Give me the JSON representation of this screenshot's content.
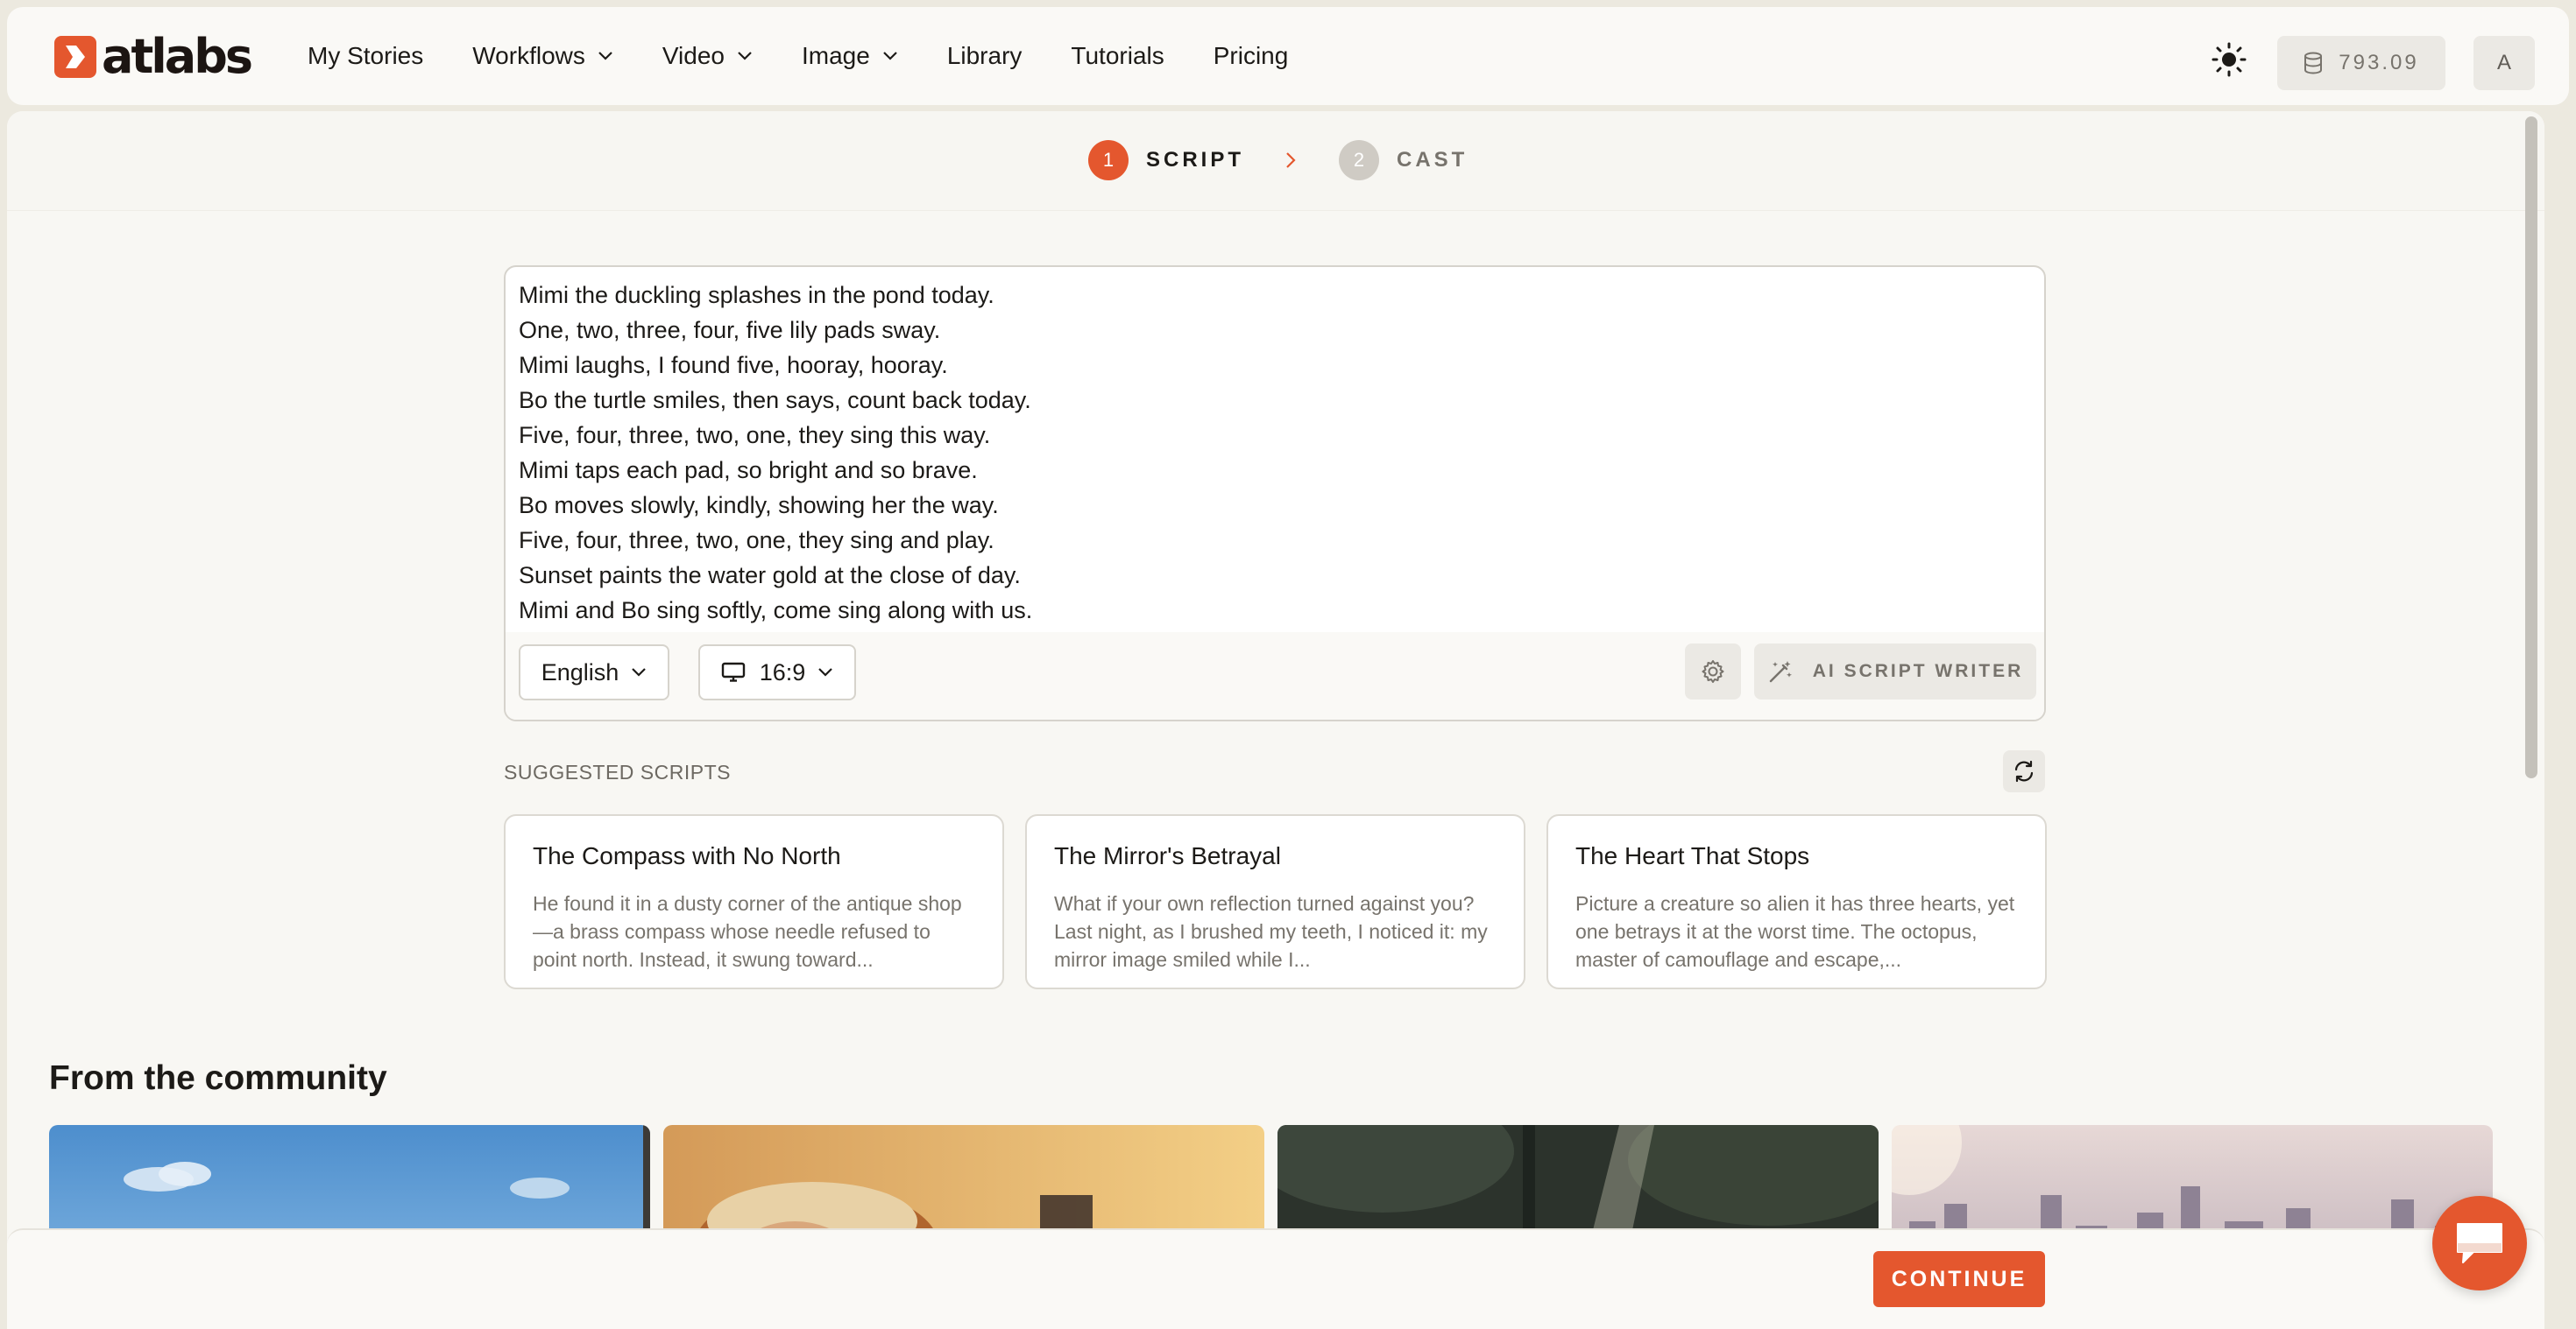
{
  "app": {
    "logo_text": "atlabs"
  },
  "nav": {
    "items": [
      {
        "label": "My Stories",
        "dropdown": false
      },
      {
        "label": "Workflows",
        "dropdown": true
      },
      {
        "label": "Video",
        "dropdown": true
      },
      {
        "label": "Image",
        "dropdown": true
      },
      {
        "label": "Library",
        "dropdown": false
      },
      {
        "label": "Tutorials",
        "dropdown": false
      },
      {
        "label": "Pricing",
        "dropdown": false
      }
    ],
    "theme_icon": "sun-icon",
    "credits": "793.09",
    "credits_icon": "database-icon",
    "avatar_initial": "A"
  },
  "steps": [
    {
      "number": "1",
      "label": "SCRIPT",
      "active": true
    },
    {
      "number": "2",
      "label": "CAST",
      "active": false
    }
  ],
  "editor": {
    "lines": [
      "Mimi the duckling splashes in the pond today.",
      "One, two, three, four, five lily pads sway.",
      "Mimi laughs, I found five, hooray, hooray.",
      "Bo the turtle smiles, then says, count back today.",
      "Five, four, three, two, one, they sing this way.",
      "Mimi taps each pad, so bright and so brave.",
      "Bo moves slowly, kindly, showing her the way.",
      "Five, four, three, two, one, they sing and play.",
      "Sunset paints the water gold at the close of day.",
      "Mimi and Bo sing softly, come sing along with us."
    ],
    "language": "English",
    "aspect_ratio": "16:9",
    "ai_writer_label": "AI SCRIPT WRITER"
  },
  "suggested": {
    "title": "SUGGESTED SCRIPTS",
    "cards": [
      {
        "title": "The Compass with No North",
        "description": "He found it in a dusty corner of the antique shop—a brass compass whose needle refused to point north. Instead, it swung toward..."
      },
      {
        "title": "The Mirror's Betrayal",
        "description": "What if your own reflection turned against you? Last night, as I brushed my teeth, I noticed it: my mirror image smiled while I..."
      },
      {
        "title": "The Heart That Stops",
        "description": "Picture a creature so alien it has three hearts, yet one betrays it at the worst time. The octopus, master of camouflage and escape,..."
      }
    ]
  },
  "community": {
    "title": "From the community"
  },
  "footer": {
    "continue_label": "CONTINUE"
  },
  "colors": {
    "accent": "#e4572e",
    "inactive_step": "#cfcbc4",
    "background": "#f8f7f3"
  }
}
